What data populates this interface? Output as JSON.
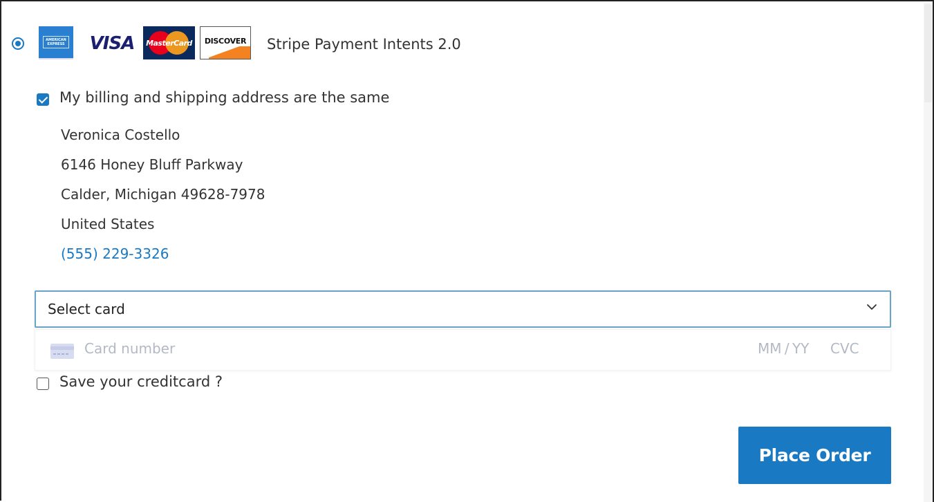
{
  "payment_method": {
    "title": "Stripe Payment Intents 2.0",
    "selected": true,
    "logos": {
      "amex": {
        "name": "american-express-icon",
        "text_line1": "AMERICAN",
        "text_line2": "EXPRESS",
        "color": "#2a7fd0"
      },
      "visa": {
        "name": "visa-icon",
        "text": "VISA",
        "color": "#1a1f71"
      },
      "mastercard": {
        "name": "mastercard-icon",
        "text": "MasterCard",
        "colors": [
          "#e8001c",
          "#f79e1b"
        ]
      },
      "discover": {
        "name": "discover-icon",
        "text": "DISCOVER",
        "color": "#f58220"
      }
    }
  },
  "billing": {
    "same_as_shipping_label": "My billing and shipping address are the same",
    "same_as_shipping_checked": true,
    "address": {
      "name": "Veronica Costello",
      "street": "6146 Honey Bluff Parkway",
      "city_state_zip": "Calder, Michigan 49628-7978",
      "country": "United States",
      "phone": "(555) 229-3326"
    }
  },
  "card": {
    "select_value": "Select card",
    "number_placeholder": "Card number",
    "expiry_placeholder": "MM / YY",
    "cvc_placeholder": "CVC",
    "save_label": "Save your creditcard ?",
    "save_checked": false
  },
  "actions": {
    "place_order_label": "Place Order"
  },
  "colors": {
    "accent": "#1979c3",
    "placeholder": "#b3b9c4",
    "text": "#333333"
  }
}
